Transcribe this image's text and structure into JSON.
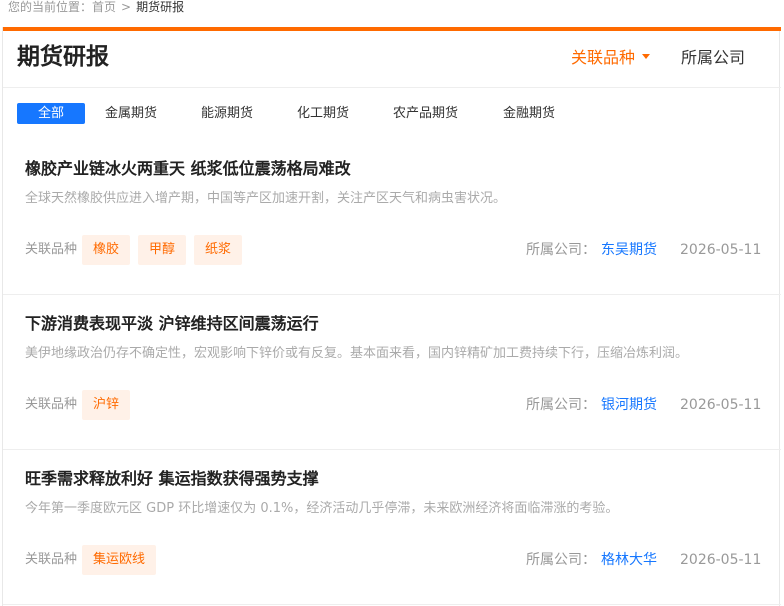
{
  "breadcrumb": {
    "prefix": "您的当前位置：",
    "home": "首页",
    "separator": ">",
    "current": "期货研报"
  },
  "page": {
    "title": "期货研报",
    "filter_related": "关联品种",
    "filter_company": "所属公司"
  },
  "tabs": [
    "全部",
    "金属期货",
    "能源期货",
    "化工期货",
    "农产品期货",
    "金融期货"
  ],
  "active_tab": "全部",
  "labels": {
    "related": "关联品种",
    "company": "所属公司："
  },
  "articles": [
    {
      "title": "橡胶产业链冰火两重天 纸浆低位震荡格局难改",
      "summary": "全球天然橡胶供应进入增产期，中国等产区加速开割，关注产区天气和病虫害状况。",
      "tags": [
        "橡胶",
        "甲醇",
        "纸浆"
      ],
      "company": "东吴期货",
      "date": "2026-05-11"
    },
    {
      "title": "下游消费表现平淡 沪锌维持区间震荡运行",
      "summary": "美伊地缘政治仍存不确定性，宏观影响下锌价或有反复。基本面来看，国内锌精矿加工费持续下行，压缩冶炼利润。",
      "tags": [
        "沪锌"
      ],
      "company": "银河期货",
      "date": "2026-05-11"
    },
    {
      "title": "旺季需求释放利好 集运指数获得强势支撑",
      "summary": "今年第一季度欧元区 GDP 环比增速仅为 0.1%，经济活动几乎停滞，未来欧洲经济将面临滞涨的考验。",
      "tags": [
        "集运欧线"
      ],
      "company": "格林大华",
      "date": "2026-05-11"
    }
  ],
  "colors": {
    "accent": "#ff6a00",
    "link": "#1677ff",
    "tag_bg": "#fff1e8"
  }
}
